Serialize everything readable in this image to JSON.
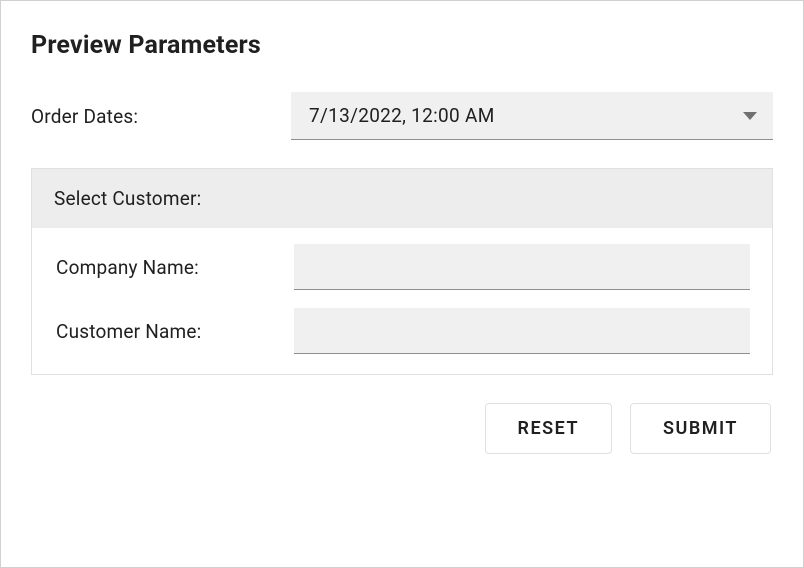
{
  "title": "Preview Parameters",
  "orderDates": {
    "label": "Order Dates:",
    "value": "7/13/2022, 12:00 AM"
  },
  "customerPanel": {
    "header": "Select Customer:",
    "companyName": {
      "label": "Company Name:",
      "value": ""
    },
    "customerName": {
      "label": "Customer Name:",
      "value": ""
    }
  },
  "actions": {
    "reset": "RESET",
    "submit": "SUBMIT"
  }
}
